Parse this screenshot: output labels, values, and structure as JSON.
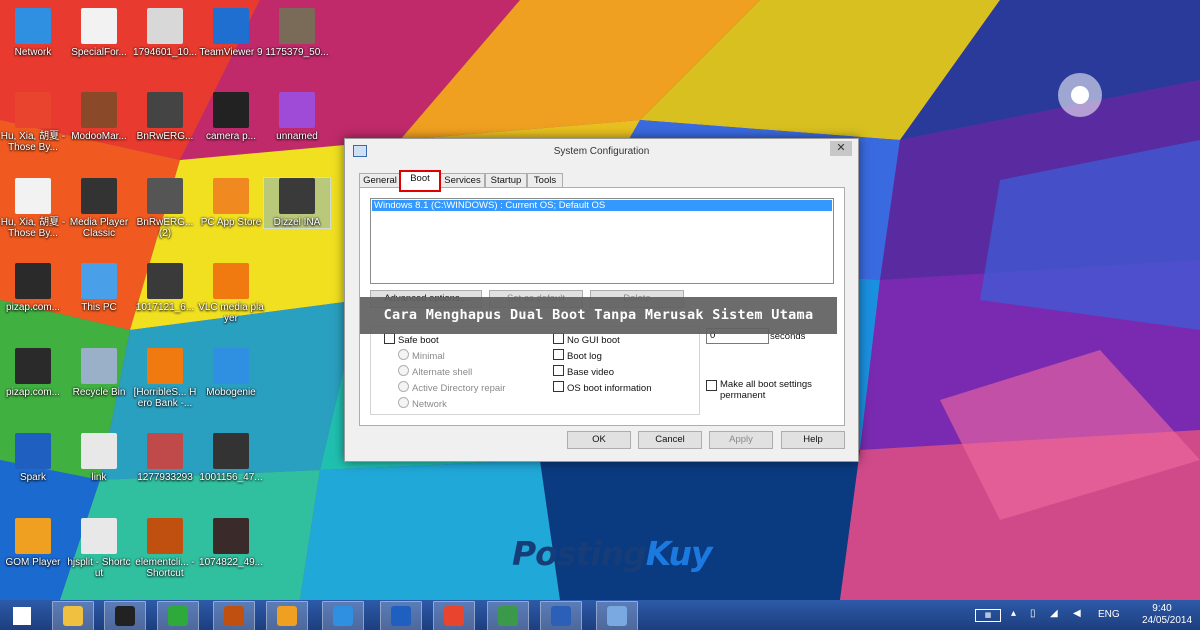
{
  "desktop": {
    "icons": [
      {
        "label": "Network",
        "icon": "network-icon",
        "color": "#2f8fe0"
      },
      {
        "label": "SpecialFor...",
        "icon": "document-shortcut-icon",
        "color": "#f2f2f2"
      },
      {
        "label": "1794601_10...",
        "icon": "image-icon",
        "color": "#d8d8d8"
      },
      {
        "label": "TeamViewer 9",
        "icon": "teamviewer-icon",
        "color": "#1e6fd0"
      },
      {
        "label": "1175379_50...",
        "icon": "photo-icon",
        "color": "#7a6a58"
      },
      {
        "label": "Hu, Xia, 胡夏 - Those By...",
        "icon": "music-app-icon",
        "color": "#e8442e"
      },
      {
        "label": "ModooMar...",
        "icon": "game-character-icon",
        "color": "#8a4a2a"
      },
      {
        "label": "BnRwERG...",
        "icon": "photo-icon",
        "color": "#444444"
      },
      {
        "label": "camera p...",
        "icon": "camera-app-icon",
        "color": "#222222"
      },
      {
        "label": "unnamed",
        "icon": "image-icon",
        "color": "#a04ad8"
      },
      {
        "label": "Hu, Xia, 胡夏 - Those By...",
        "icon": "document-icon",
        "color": "#f2f2f2"
      },
      {
        "label": "Media Player Classic",
        "icon": "media-player-icon",
        "color": "#333333"
      },
      {
        "label": "BnRwERG... (2)",
        "icon": "photo-icon",
        "color": "#555555"
      },
      {
        "label": "PC App Store",
        "icon": "app-store-icon",
        "color": "#f08a20"
      },
      {
        "label": "Dizzel INA",
        "icon": "dizzel-icon",
        "color": "#3a3a3a"
      },
      {
        "label": "pizap.com...",
        "icon": "image-icon",
        "color": "#2a2a2a"
      },
      {
        "label": "This PC",
        "icon": "computer-icon",
        "color": "#4aa0e8"
      },
      {
        "label": "1017121_6...",
        "icon": "photo-icon",
        "color": "#3a3a3a"
      },
      {
        "label": "VLC media player",
        "icon": "vlc-icon",
        "color": "#f07a10"
      },
      {
        "label": "pizap.com...",
        "icon": "image-icon",
        "color": "#2a2a2a"
      },
      {
        "label": "Recycle Bin",
        "icon": "recycle-bin-icon",
        "color": "#9ab0c8"
      },
      {
        "label": "[HorribleS... Hero Bank -...",
        "icon": "vlc-icon",
        "color": "#f07a10"
      },
      {
        "label": "Mobogenie",
        "icon": "mobogenie-icon",
        "color": "#2f8fe0"
      },
      {
        "label": "Spark",
        "icon": "shield-icon",
        "color": "#1e5fc0"
      },
      {
        "label": "link",
        "icon": "text-file-icon",
        "color": "#e8e8e8"
      },
      {
        "label": "1277933293",
        "icon": "photo-icon",
        "color": "#c04a4a"
      },
      {
        "label": "1001156_47...",
        "icon": "photo-icon",
        "color": "#333333"
      },
      {
        "label": "GOM Player",
        "icon": "gom-player-icon",
        "color": "#f0a020"
      },
      {
        "label": "hjsplit - Shortcut",
        "icon": "split-file-icon",
        "color": "#e8e8e8"
      },
      {
        "label": "elementcli... - Shortcut",
        "icon": "game-icon",
        "color": "#c05010"
      },
      {
        "label": "1074822_49...",
        "icon": "photo-icon",
        "color": "#3a2a2a"
      }
    ]
  },
  "dialog": {
    "title": "System Configuration",
    "close_label": "✕",
    "tabs": [
      "General",
      "Boot",
      "Services",
      "Startup",
      "Tools"
    ],
    "active_tab": "Boot",
    "os_list": [
      "Windows 8.1 (C:\\WINDOWS) : Current OS; Default OS"
    ],
    "buttons": {
      "advanced": "Advanced options...",
      "set_default": "Set as default",
      "delete": "Delete"
    },
    "boot_options": {
      "safe_boot": "Safe boot",
      "minimal": "Minimal",
      "alternate_shell": "Alternate shell",
      "ad_repair": "Active Directory repair",
      "network": "Network",
      "no_gui": "No GUI boot",
      "boot_log": "Boot log",
      "base_video": "Base video",
      "os_info": "OS boot information"
    },
    "timeout_value": "0",
    "seconds_label": "seconds",
    "make_permanent": "Make all boot settings permanent",
    "footer": {
      "ok": "OK",
      "cancel": "Cancel",
      "apply": "Apply",
      "help": "Help"
    }
  },
  "banner": "Cara Menghapus Dual Boot Tanpa Merusak Sistem Utama",
  "watermark": {
    "part1": "Posting",
    "part2": "Kuy"
  },
  "taskbar": {
    "items": [
      {
        "icon": "start-windows-icon",
        "color": "#ffffff"
      },
      {
        "icon": "file-explorer-icon",
        "color": "#f0c040"
      },
      {
        "icon": "bbm-icon",
        "color": "#222222"
      },
      {
        "icon": "store-icon",
        "color": "#2eaa3a"
      },
      {
        "icon": "game-icon",
        "color": "#c05010"
      },
      {
        "icon": "gom-player-icon",
        "color": "#f0a020"
      },
      {
        "icon": "mobogenie-icon",
        "color": "#2f8fe0"
      },
      {
        "icon": "shield-icon",
        "color": "#1e5fc0"
      },
      {
        "icon": "music-app-icon",
        "color": "#e8442e"
      },
      {
        "icon": "dizzel-icon",
        "color": "#3a9a4a"
      },
      {
        "icon": "word-icon",
        "color": "#2b5fb8"
      },
      {
        "icon": "system-config-icon",
        "color": "#7aa8e0"
      }
    ],
    "lang": "ENG",
    "time": "9:40",
    "date": "24/05/2014"
  }
}
